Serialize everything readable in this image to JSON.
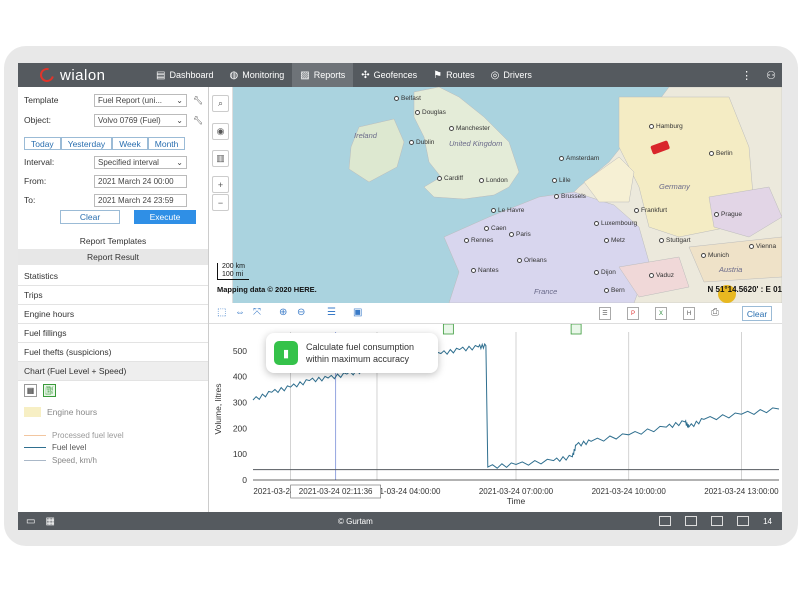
{
  "app": {
    "brand": "wialon",
    "copyright": "© Gurtam",
    "time_fragment": "14"
  },
  "nav": [
    {
      "label": "Dashboard",
      "icon": "bar-chart-icon"
    },
    {
      "label": "Monitoring",
      "icon": "globe-icon"
    },
    {
      "label": "Reports",
      "icon": "report-icon",
      "active": true
    },
    {
      "label": "Geofences",
      "icon": "geofence-icon"
    },
    {
      "label": "Routes",
      "icon": "route-icon"
    },
    {
      "label": "Drivers",
      "icon": "driver-icon"
    }
  ],
  "form": {
    "template_label": "Template",
    "template_value": "Fuel Report (uni...",
    "object_label": "Object:",
    "object_value": "Volvo 0769 (Fuel)",
    "quick": [
      "Today",
      "Yesterday",
      "Week",
      "Month"
    ],
    "interval_label": "Interval:",
    "interval_value": "Specified interval",
    "from_label": "From:",
    "from_value": "2021 March 24 00:00",
    "to_label": "To:",
    "to_value": "2021 March 24 23:59",
    "clear_label": "Clear",
    "execute_label": "Execute",
    "templates_title": "Report Templates",
    "result_title": "Report Result"
  },
  "results": [
    "Statistics",
    "Trips",
    "Engine hours",
    "Fuel fillings",
    "Fuel thefts (suspicions)",
    "Chart (Fuel Level + Speed)"
  ],
  "legend": {
    "engine_hours": "Engine hours",
    "items": [
      {
        "label": "Processed fuel level",
        "color": "#f2c6a0"
      },
      {
        "label": "Fuel level",
        "color": "#2f6f8f"
      },
      {
        "label": "Speed, km/h",
        "color": "#aab8c8"
      }
    ]
  },
  "map": {
    "cities": [
      "Belfast",
      "Douglas",
      "Manchester",
      "Dublin",
      "Cardiff",
      "London",
      "Amsterdam",
      "Hamburg",
      "Berlin",
      "Brussels",
      "Frankfurt",
      "Luxembourg",
      "Prague",
      "Paris",
      "Caen",
      "Rennes",
      "Orleans",
      "Nantes",
      "Dijon",
      "Stuttgart",
      "Munich",
      "Vaduz",
      "Bern",
      "Vienna",
      "Lille",
      "Le Havre",
      "Metz"
    ],
    "countries": [
      "Ireland",
      "United Kingdom",
      "Germany",
      "France",
      "Austria"
    ],
    "scale_km": "200 km",
    "scale_mi": "100 mi",
    "attribution": "Mapping data © 2020 HERE.",
    "coord": "N 51°14.5620' : E 01"
  },
  "toolbar": {
    "clear_label": "Clear"
  },
  "tooltip": {
    "line1": "Calculate fuel consumption",
    "line2": "within maximum accuracy"
  },
  "chart_data": {
    "type": "line",
    "ylabel": "Volume, litres",
    "xlabel": "Time",
    "ylim": [
      0,
      550
    ],
    "yticks": [
      0,
      100,
      200,
      300,
      400,
      500
    ],
    "xticks": [
      "2021-03-24 01:00:00",
      "2021-03-24 04:00:00",
      "2021-03-24 07:00:00",
      "2021-03-24 10:00:00",
      "2021-03-24 13:00:00"
    ],
    "cursor_label": "2021-03-24 02:11:36",
    "series": [
      {
        "name": "Fuel level",
        "color": "#2f6f8f",
        "x": [
          0.0,
          0.5,
          1.0,
          1.5,
          2.0,
          2.5,
          3.0,
          3.5,
          4.0,
          4.5,
          5.0,
          5.5,
          6.0,
          6.2,
          6.25,
          7.0,
          8.0,
          8.5,
          8.6,
          9.0,
          10.0,
          11.0,
          11.5,
          11.6,
          12.0,
          13.0,
          14.0
        ],
        "y": [
          310,
          340,
          360,
          385,
          395,
          410,
          425,
          440,
          455,
          470,
          490,
          505,
          515,
          520,
          50,
          60,
          75,
          90,
          135,
          150,
          175,
          205,
          225,
          205,
          235,
          255,
          275
        ]
      },
      {
        "name": "Speed, km/h",
        "color": "#555a5f",
        "x": [
          0,
          14
        ],
        "y": [
          40,
          40
        ]
      }
    ]
  }
}
